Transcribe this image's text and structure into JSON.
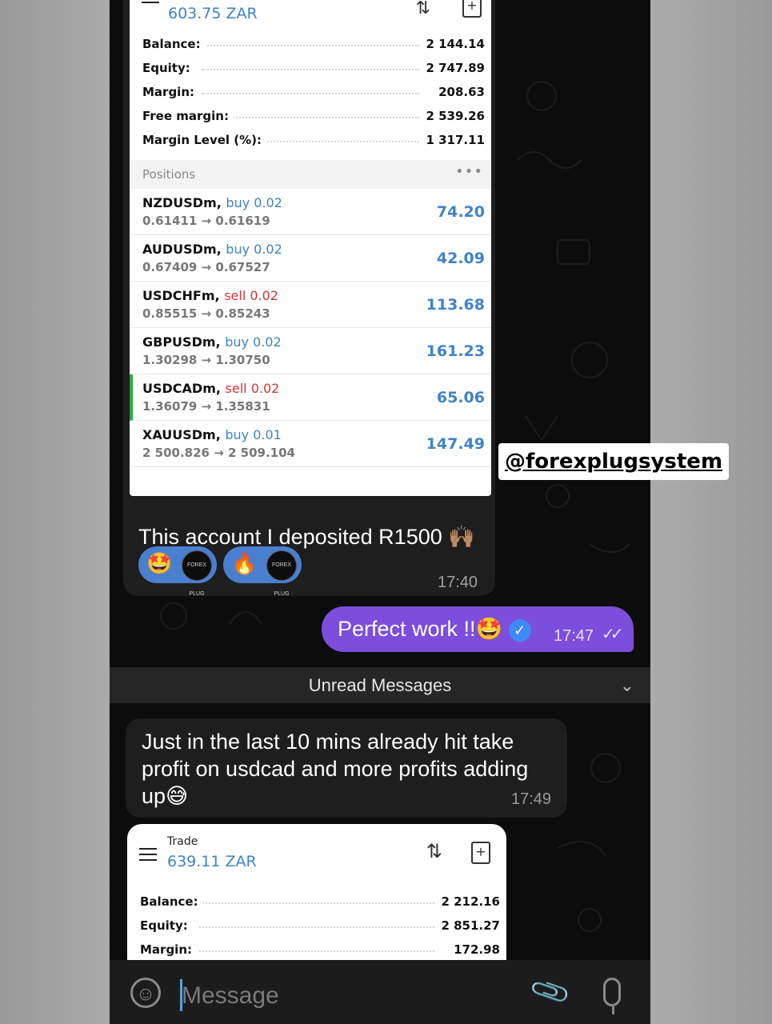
{
  "top_card": {
    "equity_header": "603.75 ZAR",
    "account": [
      {
        "label": "Balance:",
        "value": "2 144.14"
      },
      {
        "label": "Equity:",
        "value": "2 747.89"
      },
      {
        "label": "Margin:",
        "value": "208.63"
      },
      {
        "label": "Free margin:",
        "value": "2 539.26"
      },
      {
        "label": "Margin Level (%):",
        "value": "1 317.11"
      }
    ],
    "positions_title": "Positions",
    "positions_more": "•••",
    "positions": [
      {
        "symbol": "NZDUSDm,",
        "side": "buy 0.02",
        "prices": "0.61411 → 0.61619",
        "profit": "74.20"
      },
      {
        "symbol": "AUDUSDm,",
        "side": "buy 0.02",
        "prices": "0.67409 → 0.67527",
        "profit": "42.09"
      },
      {
        "symbol": "USDCHFm,",
        "side": "sell 0.02",
        "prices": "0.85515 → 0.85243",
        "profit": "113.68"
      },
      {
        "symbol": "GBPUSDm,",
        "side": "buy 0.02",
        "prices": "1.30298 → 1.30750",
        "profit": "161.23"
      },
      {
        "symbol": "USDCADm,",
        "side": "sell 0.02",
        "prices": "1.36079 → 1.35831",
        "profit": "65.06"
      },
      {
        "symbol": "XAUUSDm,",
        "side": "buy 0.01",
        "prices": "2 500.826 → 2 509.104",
        "profit": "147.49"
      }
    ]
  },
  "message1": {
    "text": "This account I deposited R1500 🙌🏽",
    "reactions": [
      {
        "emoji": "🤩",
        "avatar": "FOREX PLUG"
      },
      {
        "emoji": "🔥",
        "avatar": "FOREX PLUG"
      }
    ],
    "time": "17:40"
  },
  "watermark": "@forexplugsystem",
  "message2_outgoing": {
    "text": "Perfect work !!🤩",
    "verified_glyph": "✓",
    "time": "17:47",
    "ticks": "✓✓"
  },
  "unread_banner": {
    "label": "Unread Messages",
    "chevron": "⌄"
  },
  "message3": {
    "text": "Just in the last 10 mins already hit take profit on usdcad and more profits adding up😅",
    "time": "17:49"
  },
  "bottom_card": {
    "title": "Trade",
    "equity_header": "639.11 ZAR",
    "sort_glyph": "⇅",
    "doc_glyph": "+",
    "account": [
      {
        "label": "Balance:",
        "value": "2 212.16"
      },
      {
        "label": "Equity:",
        "value": "2 851.27"
      },
      {
        "label": "Margin:",
        "value": "172.98"
      }
    ]
  },
  "composer": {
    "placeholder": "Message",
    "emoji_glyph": "☺",
    "attach_glyph": "📎"
  },
  "colors": {
    "accent_blue": "#3f83c5",
    "sell_red": "#d03535",
    "outgoing_bubble": "#7d4ddb",
    "active_bar": "#2eaa3f"
  },
  "icons": [
    "menu-icon",
    "sort-icon",
    "new-document-icon",
    "emoji-icon",
    "attach-icon",
    "mic-icon",
    "chevron-down-icon",
    "verified-icon",
    "read-ticks-icon"
  ]
}
